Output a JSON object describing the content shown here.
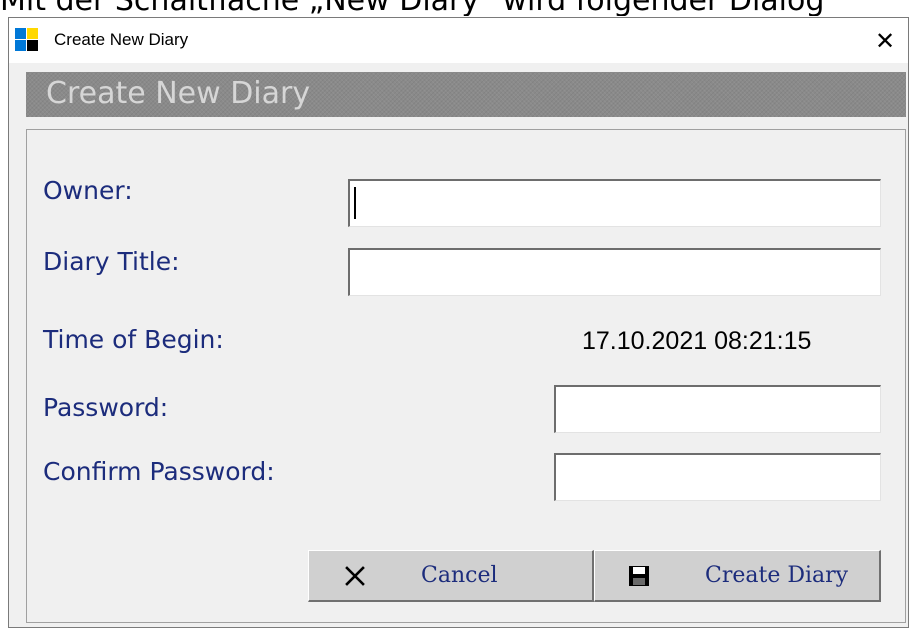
{
  "context_caption": "Mit der Schaltfläche „New Diary\" wird folgender Dialog",
  "window": {
    "title": "Create New Diary",
    "close_glyph": "✕"
  },
  "banner": {
    "title": "Create New Diary"
  },
  "form": {
    "owner_label": "Owner:",
    "owner_value": "",
    "diary_title_label": "Diary Title:",
    "diary_title_value": "",
    "time_of_begin_label": "Time of Begin:",
    "time_of_begin_value": "17.10.2021 08:21:15",
    "password_label": "Password:",
    "password_value": "",
    "confirm_password_label": "Confirm Password:",
    "confirm_password_value": ""
  },
  "buttons": {
    "cancel_label": "Cancel",
    "cancel_icon": "close-x-icon",
    "create_label": "Create Diary",
    "create_icon": "floppy-disk-icon"
  },
  "colors": {
    "label_text": "#1c2c7c",
    "banner_bg": "#8a8a8a",
    "banner_text": "#d6d6d6",
    "button_bg": "#d0d0d0"
  }
}
